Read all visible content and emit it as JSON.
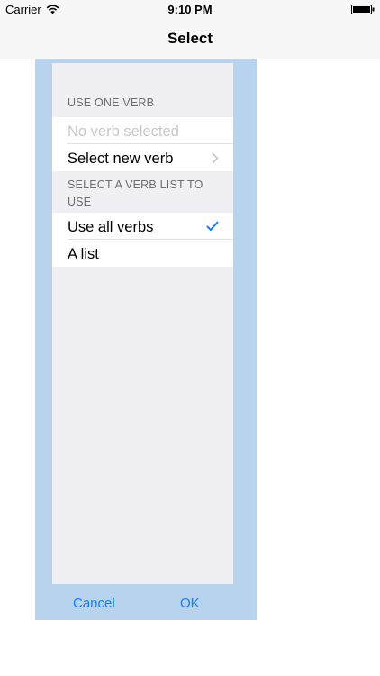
{
  "status_bar": {
    "carrier": "Carrier",
    "time": "9:10 PM"
  },
  "nav_bar": {
    "title": "Select"
  },
  "popup": {
    "background_color": "#b8d3ee",
    "sections": [
      {
        "header": "USE ONE VERB",
        "rows": [
          {
            "label": "No verb selected",
            "disabled": true
          },
          {
            "label": "Select new verb",
            "accessory": "chevron-icon"
          }
        ]
      },
      {
        "header": "SELECT A VERB LIST TO USE",
        "rows": [
          {
            "label": "Use all verbs",
            "accessory": "checkmark-icon",
            "selected": true
          },
          {
            "label": "A list"
          }
        ]
      }
    ],
    "buttons": {
      "cancel": "Cancel",
      "ok": "OK"
    },
    "accent_color": "#157efb"
  }
}
